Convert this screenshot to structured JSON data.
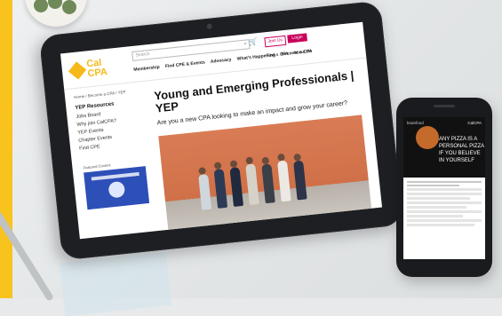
{
  "tablet": {
    "logo_line1": "Cal",
    "logo_line2": "CPA",
    "search_placeholder": "Search",
    "join_label": "Join Us",
    "login_label": "Login",
    "nav": [
      "Membership",
      "Find CPE & Events",
      "Advocacy",
      "What's Happening",
      "Become a CPA"
    ],
    "nav_right": [
      "Find a CPA",
      "About Us"
    ],
    "breadcrumb": "Home / Become a CPA / YEP",
    "sidebar_title": "YEP Resources",
    "sidebar_items": [
      "Jobs Board",
      "Why join CalCPA?",
      "YEP Events",
      "Chapter Events",
      "Find CPE"
    ],
    "featured_label": "Featured Content",
    "page_title": "Young and Emerging Professionals | YEP",
    "subtitle": "Are you a new CPA looking to make an impact and grow your career?"
  },
  "phone": {
    "ad_brand": "brainfood",
    "ad_cal": "CalCPA",
    "ad_lines": [
      "ANY PIZZA IS A",
      "PERSONAL PIZZA",
      "IF YOU BELIEVE",
      "IN YOURSELF"
    ]
  },
  "colors": {
    "accent": "#f6b91a",
    "brand_pink": "#c8005a",
    "stripe": "#f8c31c"
  },
  "icons": [
    "search-icon",
    "cart-icon"
  ]
}
